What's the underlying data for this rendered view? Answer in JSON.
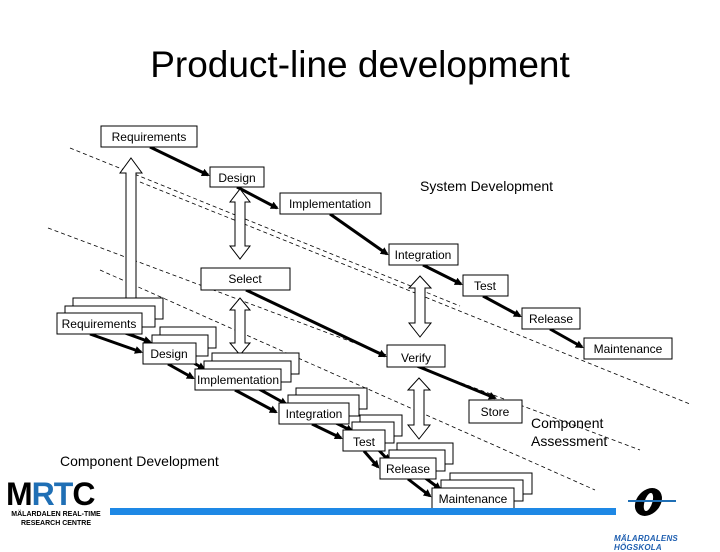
{
  "slide": {
    "title": "Product-line development"
  },
  "system_development": {
    "label": "System Development",
    "steps": [
      "Requirements",
      "Design",
      "Implementation",
      "Integration",
      "Test",
      "Release",
      "Maintenance"
    ]
  },
  "component_assessment": {
    "label_line1": "Component",
    "label_line2": "Assessment",
    "steps": [
      "Select",
      "Verify",
      "Store"
    ]
  },
  "component_development": {
    "label": "Component Development",
    "steps": [
      "Requirements",
      "Design",
      "Implementation",
      "Integration",
      "Test",
      "Release",
      "Maintenance"
    ]
  },
  "logos": {
    "mrtc_name": "MRTC",
    "mrtc_sub_line1": "MÄLARDALEN REAL-TIME",
    "mrtc_sub_line2": "RESEARCH CENTRE",
    "mdh_name": "MÄLARDALENS HÖGSKOLA"
  },
  "colors": {
    "accent_bar": "#1e88e5",
    "logo_blue": "#1f6fb5"
  }
}
